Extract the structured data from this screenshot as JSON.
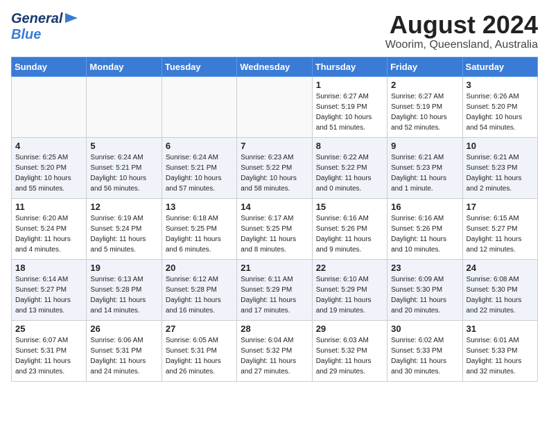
{
  "header": {
    "logo_general": "General",
    "logo_blue": "Blue",
    "month_year": "August 2024",
    "location": "Woorim, Queensland, Australia"
  },
  "days_of_week": [
    "Sunday",
    "Monday",
    "Tuesday",
    "Wednesday",
    "Thursday",
    "Friday",
    "Saturday"
  ],
  "weeks": [
    [
      {
        "day": "",
        "info": ""
      },
      {
        "day": "",
        "info": ""
      },
      {
        "day": "",
        "info": ""
      },
      {
        "day": "",
        "info": ""
      },
      {
        "day": "1",
        "info": "Sunrise: 6:27 AM\nSunset: 5:19 PM\nDaylight: 10 hours\nand 51 minutes."
      },
      {
        "day": "2",
        "info": "Sunrise: 6:27 AM\nSunset: 5:19 PM\nDaylight: 10 hours\nand 52 minutes."
      },
      {
        "day": "3",
        "info": "Sunrise: 6:26 AM\nSunset: 5:20 PM\nDaylight: 10 hours\nand 54 minutes."
      }
    ],
    [
      {
        "day": "4",
        "info": "Sunrise: 6:25 AM\nSunset: 5:20 PM\nDaylight: 10 hours\nand 55 minutes."
      },
      {
        "day": "5",
        "info": "Sunrise: 6:24 AM\nSunset: 5:21 PM\nDaylight: 10 hours\nand 56 minutes."
      },
      {
        "day": "6",
        "info": "Sunrise: 6:24 AM\nSunset: 5:21 PM\nDaylight: 10 hours\nand 57 minutes."
      },
      {
        "day": "7",
        "info": "Sunrise: 6:23 AM\nSunset: 5:22 PM\nDaylight: 10 hours\nand 58 minutes."
      },
      {
        "day": "8",
        "info": "Sunrise: 6:22 AM\nSunset: 5:22 PM\nDaylight: 11 hours\nand 0 minutes."
      },
      {
        "day": "9",
        "info": "Sunrise: 6:21 AM\nSunset: 5:23 PM\nDaylight: 11 hours\nand 1 minute."
      },
      {
        "day": "10",
        "info": "Sunrise: 6:21 AM\nSunset: 5:23 PM\nDaylight: 11 hours\nand 2 minutes."
      }
    ],
    [
      {
        "day": "11",
        "info": "Sunrise: 6:20 AM\nSunset: 5:24 PM\nDaylight: 11 hours\nand 4 minutes."
      },
      {
        "day": "12",
        "info": "Sunrise: 6:19 AM\nSunset: 5:24 PM\nDaylight: 11 hours\nand 5 minutes."
      },
      {
        "day": "13",
        "info": "Sunrise: 6:18 AM\nSunset: 5:25 PM\nDaylight: 11 hours\nand 6 minutes."
      },
      {
        "day": "14",
        "info": "Sunrise: 6:17 AM\nSunset: 5:25 PM\nDaylight: 11 hours\nand 8 minutes."
      },
      {
        "day": "15",
        "info": "Sunrise: 6:16 AM\nSunset: 5:26 PM\nDaylight: 11 hours\nand 9 minutes."
      },
      {
        "day": "16",
        "info": "Sunrise: 6:16 AM\nSunset: 5:26 PM\nDaylight: 11 hours\nand 10 minutes."
      },
      {
        "day": "17",
        "info": "Sunrise: 6:15 AM\nSunset: 5:27 PM\nDaylight: 11 hours\nand 12 minutes."
      }
    ],
    [
      {
        "day": "18",
        "info": "Sunrise: 6:14 AM\nSunset: 5:27 PM\nDaylight: 11 hours\nand 13 minutes."
      },
      {
        "day": "19",
        "info": "Sunrise: 6:13 AM\nSunset: 5:28 PM\nDaylight: 11 hours\nand 14 minutes."
      },
      {
        "day": "20",
        "info": "Sunrise: 6:12 AM\nSunset: 5:28 PM\nDaylight: 11 hours\nand 16 minutes."
      },
      {
        "day": "21",
        "info": "Sunrise: 6:11 AM\nSunset: 5:29 PM\nDaylight: 11 hours\nand 17 minutes."
      },
      {
        "day": "22",
        "info": "Sunrise: 6:10 AM\nSunset: 5:29 PM\nDaylight: 11 hours\nand 19 minutes."
      },
      {
        "day": "23",
        "info": "Sunrise: 6:09 AM\nSunset: 5:30 PM\nDaylight: 11 hours\nand 20 minutes."
      },
      {
        "day": "24",
        "info": "Sunrise: 6:08 AM\nSunset: 5:30 PM\nDaylight: 11 hours\nand 22 minutes."
      }
    ],
    [
      {
        "day": "25",
        "info": "Sunrise: 6:07 AM\nSunset: 5:31 PM\nDaylight: 11 hours\nand 23 minutes."
      },
      {
        "day": "26",
        "info": "Sunrise: 6:06 AM\nSunset: 5:31 PM\nDaylight: 11 hours\nand 24 minutes."
      },
      {
        "day": "27",
        "info": "Sunrise: 6:05 AM\nSunset: 5:31 PM\nDaylight: 11 hours\nand 26 minutes."
      },
      {
        "day": "28",
        "info": "Sunrise: 6:04 AM\nSunset: 5:32 PM\nDaylight: 11 hours\nand 27 minutes."
      },
      {
        "day": "29",
        "info": "Sunrise: 6:03 AM\nSunset: 5:32 PM\nDaylight: 11 hours\nand 29 minutes."
      },
      {
        "day": "30",
        "info": "Sunrise: 6:02 AM\nSunset: 5:33 PM\nDaylight: 11 hours\nand 30 minutes."
      },
      {
        "day": "31",
        "info": "Sunrise: 6:01 AM\nSunset: 5:33 PM\nDaylight: 11 hours\nand 32 minutes."
      }
    ]
  ]
}
